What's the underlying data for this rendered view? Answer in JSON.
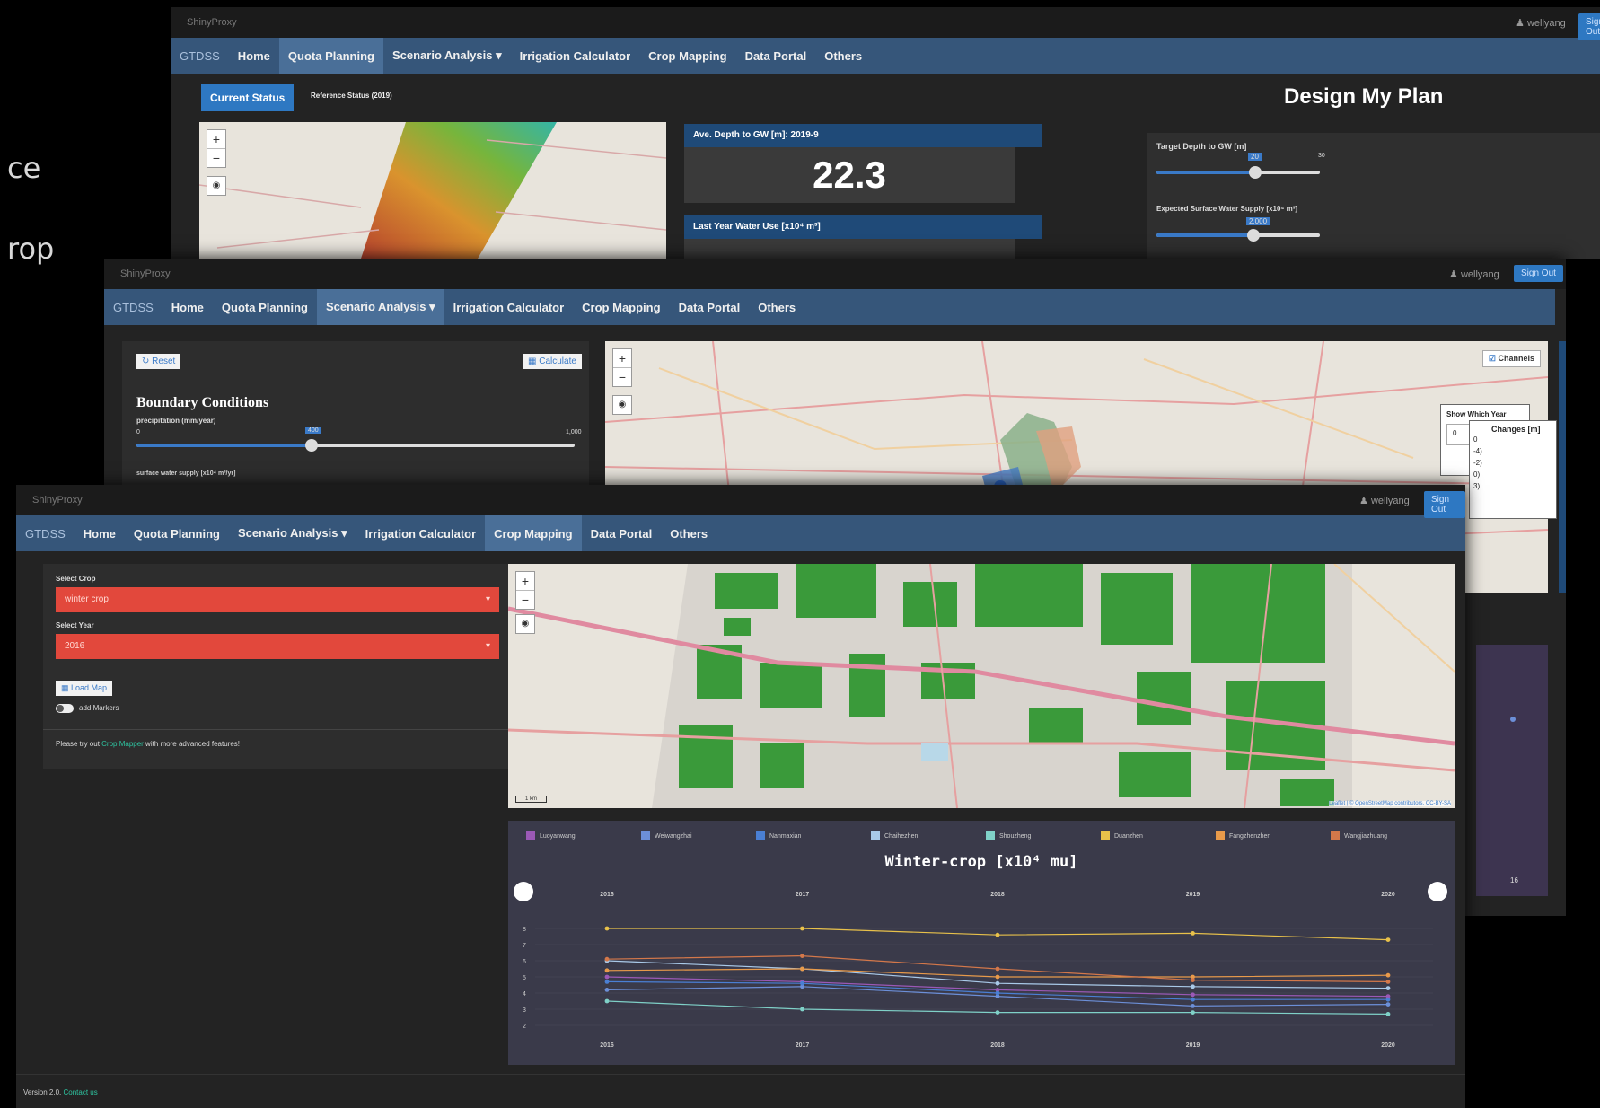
{
  "bg_fragments": [
    "ce",
    "rop"
  ],
  "common": {
    "brand": "ShinyProxy",
    "user": "wellyang",
    "signout": "Sign Out",
    "nav": [
      "GTDSS",
      "Home",
      "Quota Planning",
      "Scenario Analysis ▾",
      "Irrigation Calculator",
      "Crop Mapping",
      "Data Portal",
      "Others"
    ]
  },
  "win1": {
    "current_status": "Current Status",
    "reference_status": "Reference Status (2019)",
    "avg_depth_label": "Ave. Depth to GW [m]: 2019-9",
    "avg_depth_value": "22.3",
    "water_use_label": "Last Year Water Use [x10⁴ m³]",
    "design_title": "Design My Plan",
    "target_depth_label": "Target Depth to GW [m]",
    "target_depth_value": 20,
    "target_depth_max": 30,
    "surface_supply_label": "Expected Surface Water Supply [x10⁴ m³]",
    "surface_supply_value": "2,000"
  },
  "win2": {
    "reset": "↻ Reset",
    "calculate": "▦ Calculate",
    "boundary_title": "Boundary Conditions",
    "precip_label": "precipitation (mm/year)",
    "precip_min": "0",
    "precip_value": "400",
    "precip_max": "1,000",
    "precip_fraction": 0.4,
    "surface_label": "surface water supply [x10⁴ m³/yr]",
    "channels": "Channels",
    "show_year_label": "Show Which Year",
    "show_year_value": "0",
    "changes_label": "Changes [m]",
    "changes_items": [
      "0",
      "-4)",
      "-2)",
      "0)",
      "3)"
    ]
  },
  "win3": {
    "select_crop_label": "Select Crop",
    "select_crop_value": "winter crop",
    "select_year_label": "Select Year",
    "select_year_value": "2016",
    "load_map": "Load Map",
    "add_markers": "add Markers",
    "try_prefix": "Please try out ",
    "try_link": "Crop Mapper",
    "try_suffix": " with more advanced features!",
    "footer_version": "Version 2.0, ",
    "footer_link": "Contact us",
    "map_attrib": "Leaflet | © OpenStreetMap contributors, CC-BY-SA",
    "scale": "1 km"
  },
  "chart_data": {
    "type": "line",
    "title": "Winter-crop [x10⁴ mu]",
    "x": [
      2016,
      2017,
      2018,
      2019,
      2020
    ],
    "ylim": [
      2,
      9
    ],
    "yticks": [
      2,
      3,
      4,
      5,
      6,
      7,
      8
    ],
    "series": [
      {
        "name": "Luoyanwang",
        "color": "#9b59b6",
        "values": [
          5.0,
          4.7,
          4.2,
          3.9,
          3.8
        ]
      },
      {
        "name": "Weiwangzhai",
        "color": "#6c8fd8",
        "values": [
          4.2,
          4.4,
          3.8,
          3.2,
          3.3
        ]
      },
      {
        "name": "Nanmaxian",
        "color": "#4a7fd4",
        "values": [
          4.7,
          4.6,
          4.0,
          3.6,
          3.6
        ]
      },
      {
        "name": "Chaihezhen",
        "color": "#a9c9e8",
        "values": [
          6.0,
          5.5,
          4.6,
          4.4,
          4.3
        ]
      },
      {
        "name": "Shouzheng",
        "color": "#7fd1c8",
        "values": [
          3.5,
          3.0,
          2.8,
          2.8,
          2.7
        ]
      },
      {
        "name": "Duanzhen",
        "color": "#e8c14a",
        "values": [
          8.0,
          8.0,
          7.6,
          7.7,
          7.3
        ]
      },
      {
        "name": "Fangzhenzhen",
        "color": "#e89a4a",
        "values": [
          5.4,
          5.5,
          5.0,
          5.0,
          5.1
        ]
      },
      {
        "name": "Wangjiazhuang",
        "color": "#d4784a",
        "values": [
          6.1,
          6.3,
          5.5,
          4.8,
          4.7
        ]
      }
    ]
  }
}
